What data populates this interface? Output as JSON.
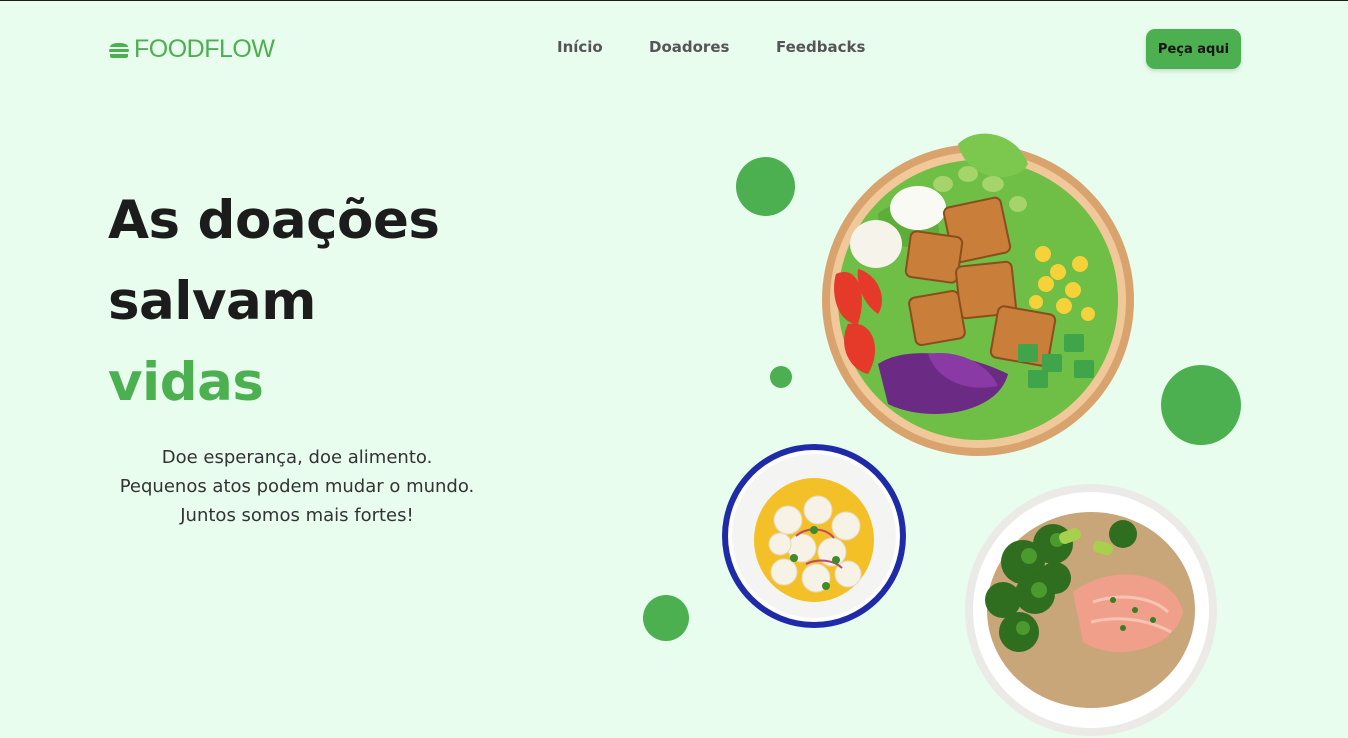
{
  "header": {
    "logo_text": "FOODFLOW",
    "logo_icon": "burger-icon",
    "nav": [
      {
        "label": "Início"
      },
      {
        "label": "Doadores"
      },
      {
        "label": "Feedbacks"
      }
    ],
    "cta_label": "Peça aqui"
  },
  "hero": {
    "title_line1": "As doações",
    "title_line2": "salvam",
    "title_accent": "vidas",
    "subtitle": "Doe esperança, doe alimento. Pequenos atos podem mudar o mundo. Juntos somos mais fortes!"
  },
  "images": [
    {
      "name": "salad-bowl-image"
    },
    {
      "name": "ceviche-bowl-image"
    },
    {
      "name": "salmon-broccoli-plate-image"
    }
  ],
  "colors": {
    "accent": "#4caf50",
    "background": "#e8fdee",
    "text_dark": "#1c1c1c",
    "nav_text": "#555555"
  }
}
